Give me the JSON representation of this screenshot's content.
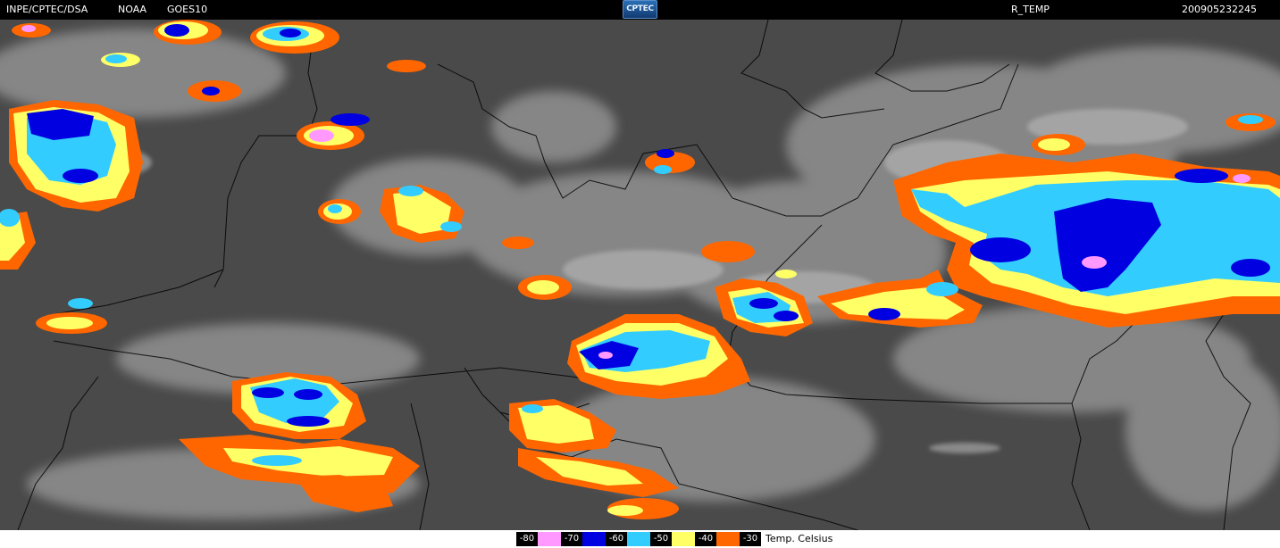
{
  "header": {
    "agency": "INPE/CPTEC/DSA",
    "satellite_org": "NOAA",
    "satellite": "GOES10",
    "logo_text": "CPTEC",
    "product": "R_TEMP",
    "timestamp": "200905232245"
  },
  "legend": {
    "title": "Temp. Celsius",
    "entries": [
      {
        "label": "-80",
        "color": "#ff99ff"
      },
      {
        "label": "-70",
        "color": "#0000e0"
      },
      {
        "label": "-60",
        "color": "#33ccff"
      },
      {
        "label": "-50",
        "color": "#ffff66"
      },
      {
        "label": "-40",
        "color": "#ff6600"
      },
      {
        "label": "-30",
        "color": "#ff6600"
      }
    ]
  },
  "map": {
    "background_color": "#4a4a4a",
    "cloud_color": "#c8c8c8",
    "border_color": "#000000"
  }
}
